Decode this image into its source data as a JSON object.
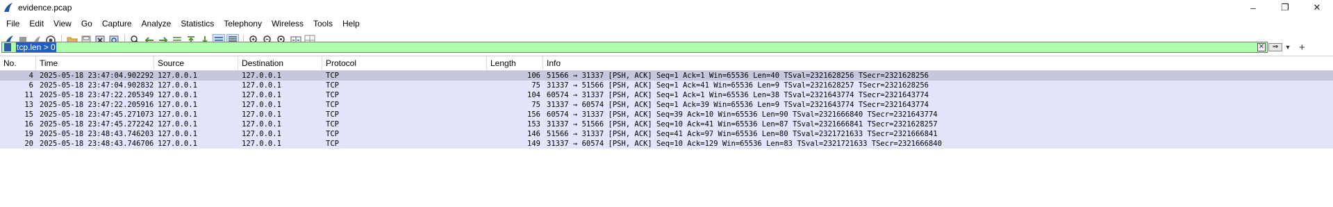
{
  "window": {
    "title": "evidence.pcap",
    "controls": [
      "–",
      "❐",
      "✕"
    ]
  },
  "menu": [
    "File",
    "Edit",
    "View",
    "Go",
    "Capture",
    "Analyze",
    "Statistics",
    "Telephony",
    "Wireless",
    "Tools",
    "Help"
  ],
  "toolbar": {
    "icons": [
      "shark-fin-start-icon",
      "stop-capture-icon",
      "restart-capture-icon",
      "capture-options-icon",
      "open-folder-icon",
      "save-file-icon",
      "close-file-icon",
      "reload-file-icon",
      "find-packet-icon",
      "go-back-icon",
      "go-forward-icon",
      "go-to-packet-icon",
      "first-packet-icon",
      "last-packet-icon",
      "autoscroll-icon",
      "colorize-icon",
      "zoom-in-icon",
      "zoom-out-icon",
      "zoom-normal-icon",
      "resize-columns-icon",
      "layout-icon"
    ]
  },
  "filter": {
    "value": "tcp.len > 0",
    "color": "#afffaf"
  },
  "columns": {
    "no": "No.",
    "time": "Time",
    "source": "Source",
    "destination": "Destination",
    "protocol": "Protocol",
    "length": "Length",
    "info": "Info"
  },
  "packets": [
    {
      "no": "4",
      "time": "2025-05-18 23:47:04.902292",
      "source": "127.0.0.1",
      "destination": "127.0.0.1",
      "protocol": "TCP",
      "length": "106",
      "info": "51566 → 31337 [PSH, ACK] Seq=1 Ack=1 Win=65536 Len=40 TSval=2321628256 TSecr=2321628256",
      "selected": true
    },
    {
      "no": "6",
      "time": "2025-05-18 23:47:04.902832",
      "source": "127.0.0.1",
      "destination": "127.0.0.1",
      "protocol": "TCP",
      "length": "75",
      "info": "31337 → 51566 [PSH, ACK] Seq=1 Ack=41 Win=65536 Len=9 TSval=2321628257 TSecr=2321628256",
      "selected": false
    },
    {
      "no": "11",
      "time": "2025-05-18 23:47:22.205349",
      "source": "127.0.0.1",
      "destination": "127.0.0.1",
      "protocol": "TCP",
      "length": "104",
      "info": "60574 → 31337 [PSH, ACK] Seq=1 Ack=1 Win=65536 Len=38 TSval=2321643774 TSecr=2321643774",
      "selected": false
    },
    {
      "no": "13",
      "time": "2025-05-18 23:47:22.205916",
      "source": "127.0.0.1",
      "destination": "127.0.0.1",
      "protocol": "TCP",
      "length": "75",
      "info": "31337 → 60574 [PSH, ACK] Seq=1 Ack=39 Win=65536 Len=9 TSval=2321643774 TSecr=2321643774",
      "selected": false
    },
    {
      "no": "15",
      "time": "2025-05-18 23:47:45.271073",
      "source": "127.0.0.1",
      "destination": "127.0.0.1",
      "protocol": "TCP",
      "length": "156",
      "info": "60574 → 31337 [PSH, ACK] Seq=39 Ack=10 Win=65536 Len=90 TSval=2321666840 TSecr=2321643774",
      "selected": false
    },
    {
      "no": "16",
      "time": "2025-05-18 23:47:45.272242",
      "source": "127.0.0.1",
      "destination": "127.0.0.1",
      "protocol": "TCP",
      "length": "153",
      "info": "31337 → 51566 [PSH, ACK] Seq=10 Ack=41 Win=65536 Len=87 TSval=2321666841 TSecr=2321628257",
      "selected": false
    },
    {
      "no": "19",
      "time": "2025-05-18 23:48:43.746203",
      "source": "127.0.0.1",
      "destination": "127.0.0.1",
      "protocol": "TCP",
      "length": "146",
      "info": "51566 → 31337 [PSH, ACK] Seq=41 Ack=97 Win=65536 Len=80 TSval=2321721633 TSecr=2321666841",
      "selected": false
    },
    {
      "no": "20",
      "time": "2025-05-18 23:48:43.746706",
      "source": "127.0.0.1",
      "destination": "127.0.0.1",
      "protocol": "TCP",
      "length": "149",
      "info": "31337 → 60574 [PSH, ACK] Seq=10 Ack=129 Win=65536 Len=83 TSval=2321721633 TSecr=2321666840",
      "selected": false
    }
  ],
  "colors": {
    "row_bg": "#e4e4fc",
    "selected_row_bg": "#c6c6de",
    "filter_bg": "#afffaf"
  }
}
